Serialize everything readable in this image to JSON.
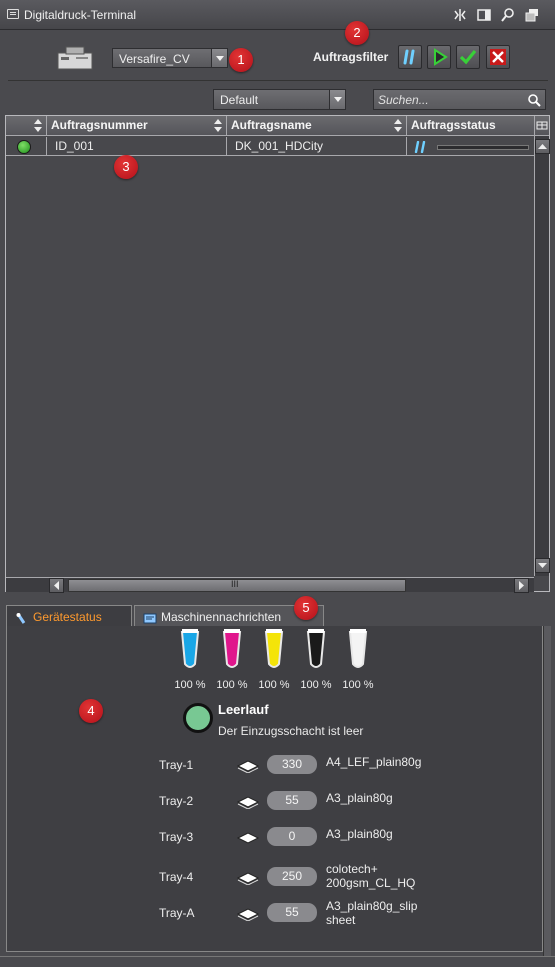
{
  "window": {
    "title": "Digitaldruck-Terminal"
  },
  "toolbar": {
    "device": "Versafire_CV",
    "filter_label": "Auftragsfilter",
    "view": "Default",
    "search_placeholder": "Suchen..."
  },
  "badges": [
    "1",
    "2",
    "3",
    "4",
    "5"
  ],
  "table": {
    "columns": [
      "Auftragsnummer",
      "Auftragsname",
      "Auftragsstatus"
    ],
    "rows": [
      {
        "number": "ID_001",
        "name": "DK_001_HDCity",
        "status": "paused"
      }
    ]
  },
  "tabs": [
    {
      "label": "Gerätestatus",
      "active": true
    },
    {
      "label": "Maschinennachrichten",
      "active": false
    }
  ],
  "inks": [
    {
      "name": "cyan",
      "color": "#19a6e6",
      "level": "100 %"
    },
    {
      "name": "magenta",
      "color": "#e0168c",
      "level": "100 %"
    },
    {
      "name": "yellow",
      "color": "#f4e409",
      "level": "100 %"
    },
    {
      "name": "black",
      "color": "#1a1a1a",
      "level": "100 %"
    },
    {
      "name": "white",
      "color": "#f4f4f4",
      "level": "100 %"
    }
  ],
  "device_status": {
    "state": "Leerlauf",
    "message": "Der Einzugsschacht ist leer",
    "color": "#78c893"
  },
  "trays": [
    {
      "name": "Tray-1",
      "count": "330",
      "media": [
        "A4_LEF_plain80g"
      ]
    },
    {
      "name": "Tray-2",
      "count": "55",
      "media": [
        "A3_plain80g"
      ]
    },
    {
      "name": "Tray-3",
      "count": "0",
      "media": [
        "A3_plain80g"
      ]
    },
    {
      "name": "Tray-4",
      "count": "250",
      "media": [
        "colotech+",
        "200gsm_CL_HQ"
      ]
    },
    {
      "name": "Tray-A",
      "count": "55",
      "media": [
        "A3_plain80g_slip",
        "sheet"
      ]
    }
  ],
  "scroll": {
    "hthumb_label": "III"
  }
}
